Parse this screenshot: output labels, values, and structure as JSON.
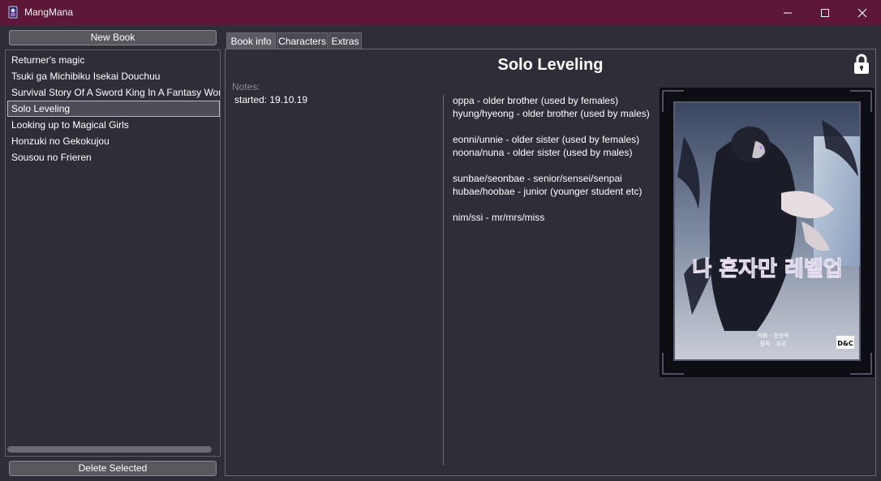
{
  "window": {
    "title": "MangMana",
    "minimize_label": "—",
    "maximize_label": "☐",
    "close_label": "✕"
  },
  "sidebar": {
    "new_book_label": "New Book",
    "delete_label": "Delete Selected",
    "books": [
      "Returner's magic",
      "Tsuki ga Michibiku Isekai Douchuu",
      "Survival Story Of A Sword King In A Fantasy World",
      "Solo Leveling",
      "Looking up to Magical Girls",
      "Honzuki no Gekokujou",
      "Sousou no Frieren"
    ],
    "selected_index": 3
  },
  "tabs": [
    "Book info",
    "Characters",
    "Extras"
  ],
  "active_tab": "Book info",
  "book": {
    "title": "Solo Leveling",
    "notes_label": "Notes:",
    "notes": "started: 19.10.19",
    "glossary": [
      "oppa - older brother (used by females)",
      "hyung/hyeong - older brother (used by males)",
      "",
      "eonni/unnie - older sister (used by females)",
      "noona/nuna - older sister (used by males)",
      "",
      "sunbae/seonbae - senior/sensei/senpai",
      "hubae/hoobae - junior (younger student etc)",
      "",
      "nim/ssi - mr/mrs/miss"
    ],
    "cover_title_korean": "나 혼자만 레벨업",
    "cover_credit_1": "원작 · 추공",
    "cover_credit_2": "작화 · 장성락",
    "cover_publisher": "D&C"
  },
  "colors": {
    "titlebar": "#5d1838",
    "background": "#2e2e38",
    "selection": "#4d4d57"
  }
}
